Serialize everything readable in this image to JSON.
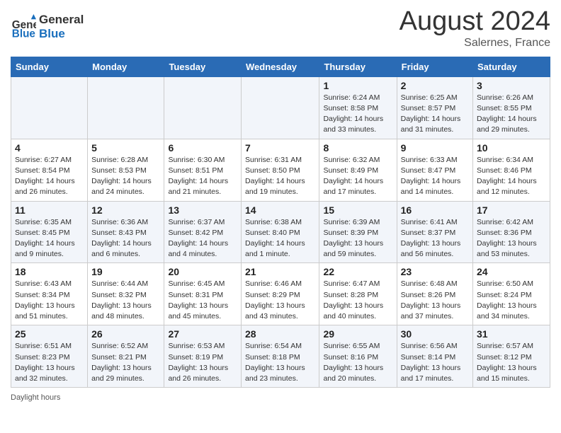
{
  "header": {
    "logo_line1": "General",
    "logo_line2": "Blue",
    "month_year": "August 2024",
    "location": "Salernes, France"
  },
  "days_of_week": [
    "Sunday",
    "Monday",
    "Tuesday",
    "Wednesday",
    "Thursday",
    "Friday",
    "Saturday"
  ],
  "weeks": [
    [
      {
        "day": "",
        "info": ""
      },
      {
        "day": "",
        "info": ""
      },
      {
        "day": "",
        "info": ""
      },
      {
        "day": "",
        "info": ""
      },
      {
        "day": "1",
        "info": "Sunrise: 6:24 AM\nSunset: 8:58 PM\nDaylight: 14 hours\nand 33 minutes."
      },
      {
        "day": "2",
        "info": "Sunrise: 6:25 AM\nSunset: 8:57 PM\nDaylight: 14 hours\nand 31 minutes."
      },
      {
        "day": "3",
        "info": "Sunrise: 6:26 AM\nSunset: 8:55 PM\nDaylight: 14 hours\nand 29 minutes."
      }
    ],
    [
      {
        "day": "4",
        "info": "Sunrise: 6:27 AM\nSunset: 8:54 PM\nDaylight: 14 hours\nand 26 minutes."
      },
      {
        "day": "5",
        "info": "Sunrise: 6:28 AM\nSunset: 8:53 PM\nDaylight: 14 hours\nand 24 minutes."
      },
      {
        "day": "6",
        "info": "Sunrise: 6:30 AM\nSunset: 8:51 PM\nDaylight: 14 hours\nand 21 minutes."
      },
      {
        "day": "7",
        "info": "Sunrise: 6:31 AM\nSunset: 8:50 PM\nDaylight: 14 hours\nand 19 minutes."
      },
      {
        "day": "8",
        "info": "Sunrise: 6:32 AM\nSunset: 8:49 PM\nDaylight: 14 hours\nand 17 minutes."
      },
      {
        "day": "9",
        "info": "Sunrise: 6:33 AM\nSunset: 8:47 PM\nDaylight: 14 hours\nand 14 minutes."
      },
      {
        "day": "10",
        "info": "Sunrise: 6:34 AM\nSunset: 8:46 PM\nDaylight: 14 hours\nand 12 minutes."
      }
    ],
    [
      {
        "day": "11",
        "info": "Sunrise: 6:35 AM\nSunset: 8:45 PM\nDaylight: 14 hours\nand 9 minutes."
      },
      {
        "day": "12",
        "info": "Sunrise: 6:36 AM\nSunset: 8:43 PM\nDaylight: 14 hours\nand 6 minutes."
      },
      {
        "day": "13",
        "info": "Sunrise: 6:37 AM\nSunset: 8:42 PM\nDaylight: 14 hours\nand 4 minutes."
      },
      {
        "day": "14",
        "info": "Sunrise: 6:38 AM\nSunset: 8:40 PM\nDaylight: 14 hours\nand 1 minute."
      },
      {
        "day": "15",
        "info": "Sunrise: 6:39 AM\nSunset: 8:39 PM\nDaylight: 13 hours\nand 59 minutes."
      },
      {
        "day": "16",
        "info": "Sunrise: 6:41 AM\nSunset: 8:37 PM\nDaylight: 13 hours\nand 56 minutes."
      },
      {
        "day": "17",
        "info": "Sunrise: 6:42 AM\nSunset: 8:36 PM\nDaylight: 13 hours\nand 53 minutes."
      }
    ],
    [
      {
        "day": "18",
        "info": "Sunrise: 6:43 AM\nSunset: 8:34 PM\nDaylight: 13 hours\nand 51 minutes."
      },
      {
        "day": "19",
        "info": "Sunrise: 6:44 AM\nSunset: 8:32 PM\nDaylight: 13 hours\nand 48 minutes."
      },
      {
        "day": "20",
        "info": "Sunrise: 6:45 AM\nSunset: 8:31 PM\nDaylight: 13 hours\nand 45 minutes."
      },
      {
        "day": "21",
        "info": "Sunrise: 6:46 AM\nSunset: 8:29 PM\nDaylight: 13 hours\nand 43 minutes."
      },
      {
        "day": "22",
        "info": "Sunrise: 6:47 AM\nSunset: 8:28 PM\nDaylight: 13 hours\nand 40 minutes."
      },
      {
        "day": "23",
        "info": "Sunrise: 6:48 AM\nSunset: 8:26 PM\nDaylight: 13 hours\nand 37 minutes."
      },
      {
        "day": "24",
        "info": "Sunrise: 6:50 AM\nSunset: 8:24 PM\nDaylight: 13 hours\nand 34 minutes."
      }
    ],
    [
      {
        "day": "25",
        "info": "Sunrise: 6:51 AM\nSunset: 8:23 PM\nDaylight: 13 hours\nand 32 minutes."
      },
      {
        "day": "26",
        "info": "Sunrise: 6:52 AM\nSunset: 8:21 PM\nDaylight: 13 hours\nand 29 minutes."
      },
      {
        "day": "27",
        "info": "Sunrise: 6:53 AM\nSunset: 8:19 PM\nDaylight: 13 hours\nand 26 minutes."
      },
      {
        "day": "28",
        "info": "Sunrise: 6:54 AM\nSunset: 8:18 PM\nDaylight: 13 hours\nand 23 minutes."
      },
      {
        "day": "29",
        "info": "Sunrise: 6:55 AM\nSunset: 8:16 PM\nDaylight: 13 hours\nand 20 minutes."
      },
      {
        "day": "30",
        "info": "Sunrise: 6:56 AM\nSunset: 8:14 PM\nDaylight: 13 hours\nand 17 minutes."
      },
      {
        "day": "31",
        "info": "Sunrise: 6:57 AM\nSunset: 8:12 PM\nDaylight: 13 hours\nand 15 minutes."
      }
    ]
  ],
  "footer": {
    "label": "Daylight hours"
  }
}
